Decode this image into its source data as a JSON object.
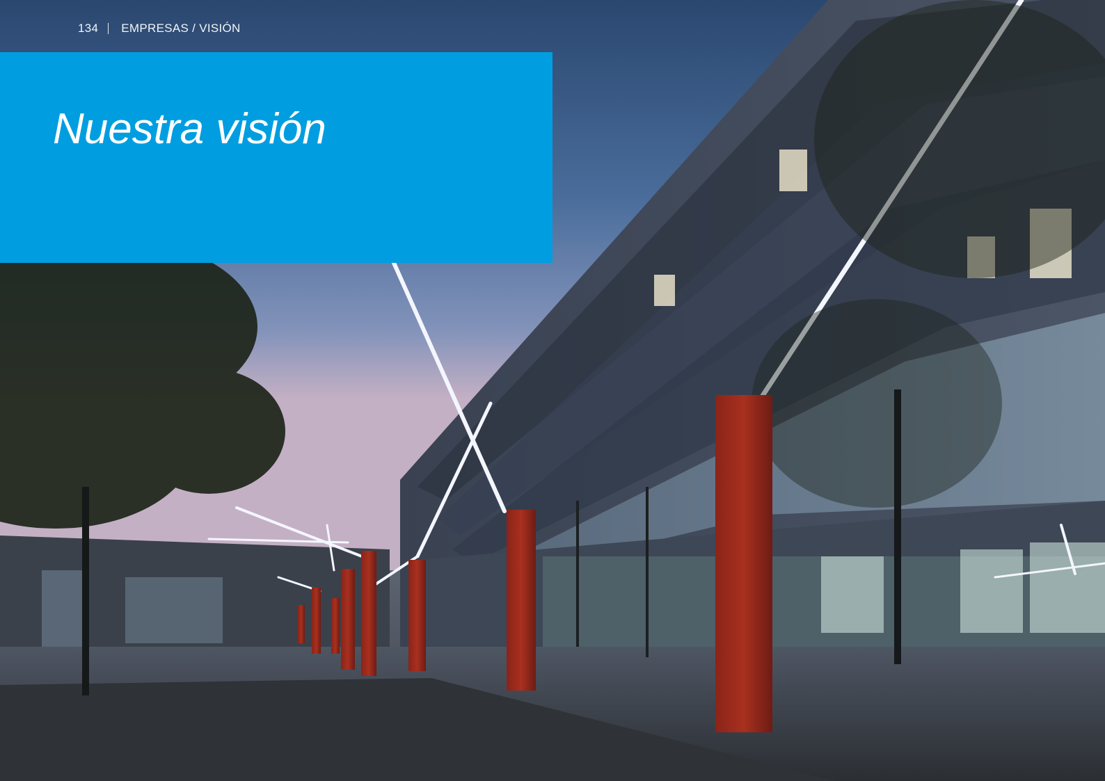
{
  "header": {
    "page_number": "134",
    "section": "EMPRESAS / VISIÓN"
  },
  "title_block": {
    "title": "Nuestra visión",
    "background_color": "#009ee0"
  },
  "photo": {
    "subject": "building-at-dusk-with-red-pillars-and-light-beams"
  }
}
